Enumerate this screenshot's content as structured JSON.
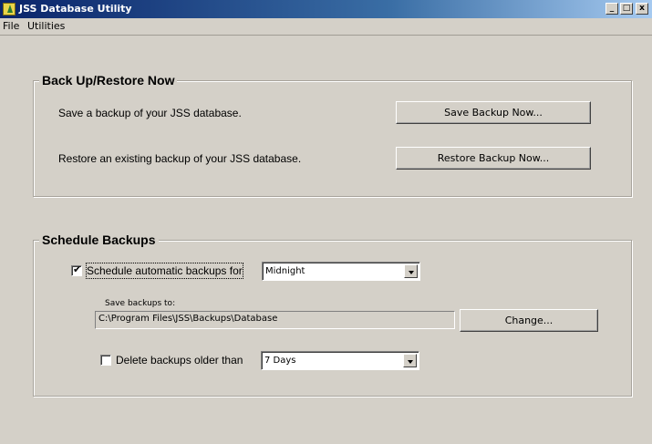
{
  "window": {
    "title": "JSS Database Utility",
    "minimize_glyph": "_",
    "maximize_glyph": "□",
    "close_glyph": "x"
  },
  "menu": {
    "items": [
      {
        "label": "File"
      },
      {
        "label": "Utilities"
      }
    ]
  },
  "backup_restore": {
    "title": "Back Up/Restore Now",
    "save_text": "Save a backup of your JSS database.",
    "save_button": "Save Backup Now...",
    "restore_text": "Restore an existing backup of your JSS database.",
    "restore_button": "Restore Backup Now..."
  },
  "schedule": {
    "title": "Schedule Backups",
    "auto_label": "Schedule automatic backups for",
    "auto_checked": true,
    "auto_value": "Midnight",
    "save_to_label": "Save backups to:",
    "path": "C:\\Program Files\\JSS\\Backups\\Database",
    "change_button": "Change...",
    "delete_label": "Delete backups older than",
    "delete_checked": false,
    "delete_value": "7 Days"
  },
  "icons": {
    "check": "✔"
  }
}
